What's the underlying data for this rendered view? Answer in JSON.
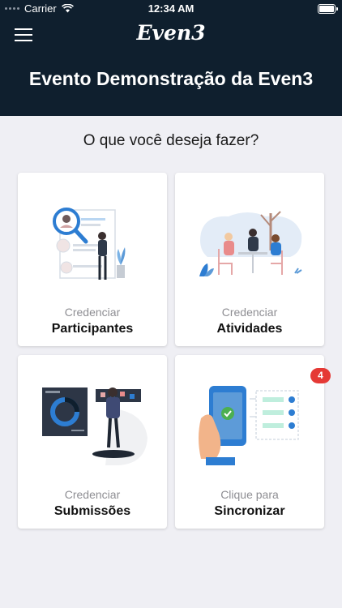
{
  "status_bar": {
    "carrier": "Carrier",
    "time": "12:34 AM"
  },
  "header": {
    "logo": "Even3",
    "title": "Evento Demonstração da Even3"
  },
  "question": "O que você deseja fazer?",
  "cards": [
    {
      "small": "Credenciar",
      "big": "Participantes",
      "icon": "participants-illustration"
    },
    {
      "small": "Credenciar",
      "big": "Atividades",
      "icon": "activities-illustration"
    },
    {
      "small": "Credenciar",
      "big": "Submissões",
      "icon": "submissions-illustration"
    },
    {
      "small": "Clique para",
      "big": "Sincronizar",
      "icon": "sync-illustration",
      "badge": "4"
    }
  ],
  "colors": {
    "header_bg": "#0f1f2e",
    "accent": "#2d7dd2",
    "badge": "#e53935"
  }
}
